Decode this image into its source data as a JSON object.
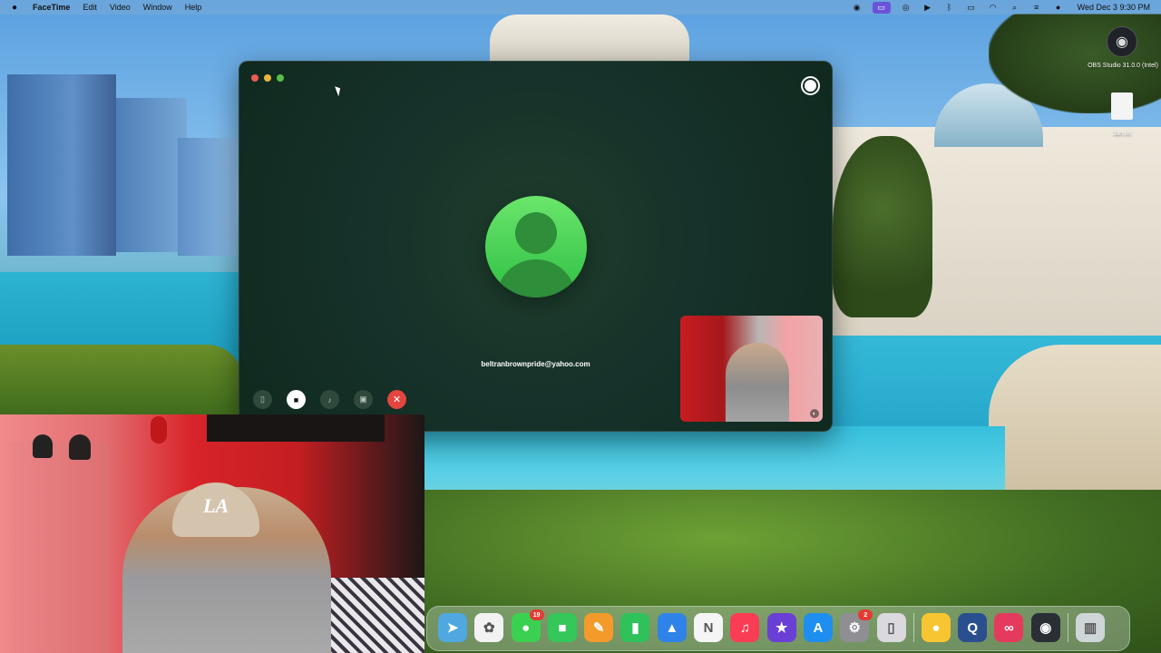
{
  "menubar": {
    "app_name": "FaceTime",
    "menus": [
      "Edit",
      "Video",
      "Window",
      "Help"
    ],
    "datetime": "Wed Dec 3  9:30 PM",
    "status_icons": [
      "obs-tray-icon",
      "screen-mirroring-icon",
      "screen-record-icon",
      "play-icon",
      "bluetooth-icon",
      "battery-icon",
      "wifi-icon",
      "spotlight-icon",
      "control-center-icon",
      "siri-icon"
    ]
  },
  "facetime": {
    "callee": "beltranbrownpride@yahoo.com",
    "controls": [
      {
        "name": "sidebar-button",
        "icon": "sidebar-icon",
        "glyph": "▯"
      },
      {
        "name": "camera-button",
        "icon": "video-camera-icon",
        "glyph": "■"
      },
      {
        "name": "mute-button",
        "icon": "microphone-icon",
        "glyph": "♪"
      },
      {
        "name": "share-screen-button",
        "icon": "screen-share-icon",
        "glyph": "▣"
      },
      {
        "name": "end-call-button",
        "icon": "close-icon",
        "glyph": "✕"
      }
    ]
  },
  "desktop": {
    "obs_label": "OBS Studio 31.0.0 (Intel)",
    "file_label": "Jan.us"
  },
  "webcam": {
    "cap_logo": "LA"
  },
  "dock": {
    "apps": [
      {
        "name": "Maps",
        "icon": "maps-icon",
        "color": "#4fa8e0",
        "glyph": "➤"
      },
      {
        "name": "Photos",
        "icon": "photos-icon",
        "color": "#f2f2f2",
        "glyph": "✿"
      },
      {
        "name": "Messages",
        "icon": "messages-icon",
        "color": "#3ad150",
        "glyph": "●",
        "badge": "19"
      },
      {
        "name": "FaceTime",
        "icon": "facetime-icon",
        "color": "#35c759",
        "glyph": "■"
      },
      {
        "name": "Pages",
        "icon": "pages-icon",
        "color": "#f39a2b",
        "glyph": "✎"
      },
      {
        "name": "Numbers",
        "icon": "numbers-icon",
        "color": "#2fc15a",
        "glyph": "▮"
      },
      {
        "name": "Keynote",
        "icon": "keynote-icon",
        "color": "#2f82e8",
        "glyph": "▲"
      },
      {
        "name": "News",
        "icon": "news-icon",
        "color": "#f5f5f5",
        "glyph": "N"
      },
      {
        "name": "Music",
        "icon": "music-icon",
        "color": "#fa3c54",
        "glyph": "♫"
      },
      {
        "name": "iMovie",
        "icon": "imovie-icon",
        "color": "#6a3fd6",
        "glyph": "★"
      },
      {
        "name": "App Store",
        "icon": "app-store-icon",
        "color": "#1e8ff0",
        "glyph": "A"
      },
      {
        "name": "System Settings",
        "icon": "settings-icon",
        "color": "#8e8e93",
        "glyph": "⚙",
        "badge": "2"
      },
      {
        "name": "iPhone Mirroring",
        "icon": "iphone-mirroring-icon",
        "color": "#d9d9de",
        "glyph": "▯"
      },
      {
        "name": "Tips",
        "icon": "tips-icon",
        "color": "#f7c531",
        "glyph": "●"
      },
      {
        "name": "QuickTime",
        "icon": "quicktime-icon",
        "color": "#2a4f8f",
        "glyph": "Q"
      },
      {
        "name": "Creative Cloud",
        "icon": "creative-cloud-icon",
        "color": "#e43a5d",
        "glyph": "∞"
      },
      {
        "name": "OBS",
        "icon": "obs-icon",
        "color": "#2a2e35",
        "glyph": "◉"
      },
      {
        "name": "Trash",
        "icon": "trash-icon",
        "color": "#cfd6d8",
        "glyph": "▥"
      }
    ]
  }
}
